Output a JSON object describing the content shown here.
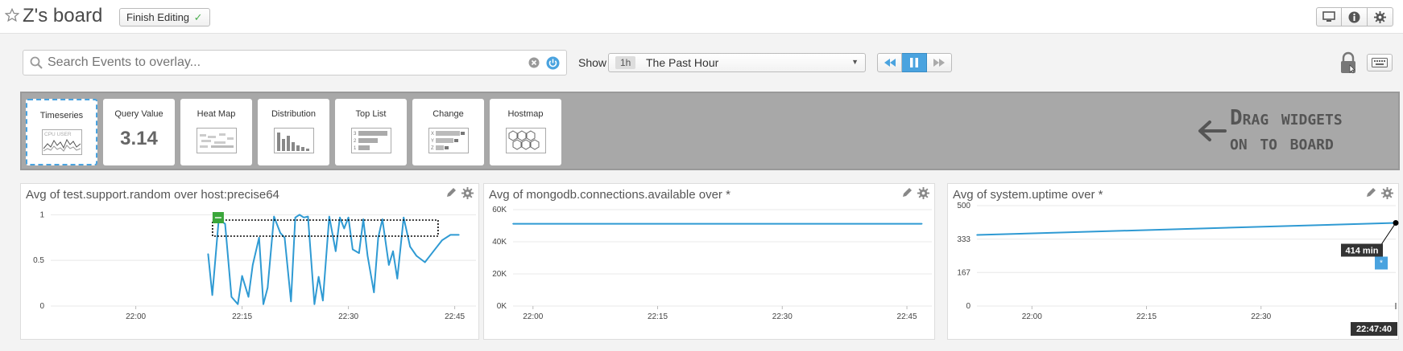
{
  "header": {
    "title": "Z's board",
    "finish_label": "Finish Editing",
    "finish_check": "✓",
    "icons": [
      "monitor-icon",
      "info-icon",
      "gear-icon"
    ]
  },
  "controls": {
    "search_placeholder": "Search Events to overlay...",
    "show_label": "Show",
    "time_badge": "1h",
    "time_value": "The Past Hour",
    "accent": "#4aa3df"
  },
  "tray": {
    "widgets": [
      {
        "label": "Timeseries",
        "icon": "timeseries-icon"
      },
      {
        "label": "Query Value",
        "value": "3.14"
      },
      {
        "label": "Heat Map",
        "icon": "heatmap-icon"
      },
      {
        "label": "Distribution",
        "icon": "distribution-icon"
      },
      {
        "label": "Top List",
        "icon": "toplist-icon"
      },
      {
        "label": "Change",
        "icon": "change-icon"
      },
      {
        "label": "Hostmap",
        "icon": "hostmap-icon"
      }
    ],
    "drag_line1": "Drag widgets",
    "drag_line2": "on to board",
    "timeseries_mini_text": "CPU USER"
  },
  "panels": [
    {
      "title": "Avg of test.support.random over host:precise64"
    },
    {
      "title": "Avg of mongodb.connections.available over *"
    },
    {
      "title": "Avg of system.uptime over *",
      "tooltip": "414 min",
      "time_label": "22:47:40"
    }
  ],
  "chart_data": [
    {
      "type": "line",
      "title": "Avg of test.support.random over host:precise64",
      "x_ticks": [
        "22:00",
        "22:15",
        "22:30",
        "22:45"
      ],
      "y_ticks": [
        "0",
        "0.5",
        "1"
      ],
      "ylim": [
        0,
        1.1
      ],
      "color": "#2f9ad3",
      "x": [
        22.17,
        22.18,
        22.195,
        22.21,
        22.225,
        22.24,
        22.25,
        22.265,
        22.275,
        22.29,
        22.3,
        22.31,
        22.325,
        22.34,
        22.35,
        22.365,
        22.375,
        22.385,
        22.395,
        22.405,
        22.42,
        22.43,
        22.44,
        22.455,
        22.47,
        22.48,
        22.49,
        22.5,
        22.51,
        22.525,
        22.535,
        22.545,
        22.56,
        22.57,
        22.58,
        22.595,
        22.605,
        22.615,
        22.63,
        22.645,
        22.66,
        22.68,
        22.7,
        22.72,
        22.74,
        22.76
      ],
      "values": [
        0.57,
        0.12,
        0.95,
        0.9,
        0.1,
        0.02,
        0.33,
        0.1,
        0.45,
        0.75,
        0.02,
        0.2,
        0.98,
        0.8,
        0.75,
        0.05,
        0.97,
        1.0,
        0.97,
        0.98,
        0.02,
        0.32,
        0.06,
        0.98,
        0.6,
        0.97,
        0.85,
        0.97,
        0.62,
        0.58,
        0.95,
        0.55,
        0.15,
        0.75,
        0.95,
        0.45,
        0.6,
        0.3,
        0.97,
        0.65,
        0.55,
        0.48,
        0.6,
        0.72,
        0.78,
        0.78
      ],
      "event_marker_x": 22.19
    },
    {
      "type": "line",
      "title": "Avg of mongodb.connections.available over *",
      "x_ticks": [
        "22:00",
        "22:15",
        "22:30",
        "22:45"
      ],
      "y_ticks": [
        "0K",
        "20K",
        "40K",
        "60K"
      ],
      "ylim": [
        0,
        65000
      ],
      "color": "#2f9ad3",
      "x": [
        21.96,
        22.78
      ],
      "values": [
        51200,
        51200
      ]
    },
    {
      "type": "line",
      "title": "Avg of system.uptime over *",
      "x_ticks": [
        "22:00",
        "22:15",
        "22:30"
      ],
      "y_ticks": [
        "0",
        "167",
        "333",
        "500"
      ],
      "ylim": [
        0,
        500
      ],
      "color": "#2f9ad3",
      "x": [
        21.88,
        22.794
      ],
      "values": [
        354,
        414
      ]
    }
  ]
}
